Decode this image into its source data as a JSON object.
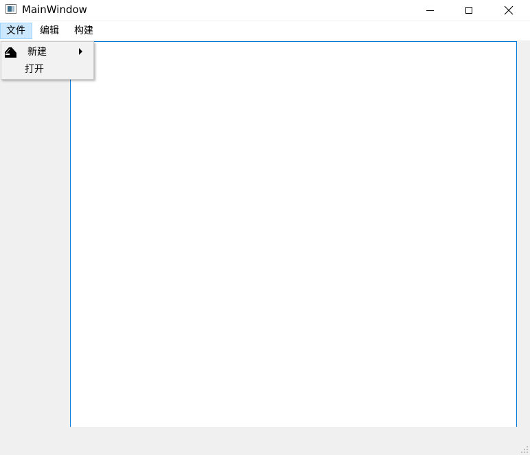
{
  "window": {
    "title": "MainWindow"
  },
  "menubar": {
    "items": [
      {
        "label": "文件"
      },
      {
        "label": "编辑"
      },
      {
        "label": "构建"
      }
    ]
  },
  "file_menu": {
    "items": [
      {
        "label": "新建",
        "icon": "new-file-icon",
        "has_submenu": true
      },
      {
        "label": "打开",
        "icon": "",
        "has_submenu": false
      }
    ]
  },
  "colors": {
    "menu_highlight": "#cce8ff",
    "menu_highlight_border": "#99d1ff",
    "editor_border": "#0078d7",
    "window_background": "#f0f0f0"
  }
}
